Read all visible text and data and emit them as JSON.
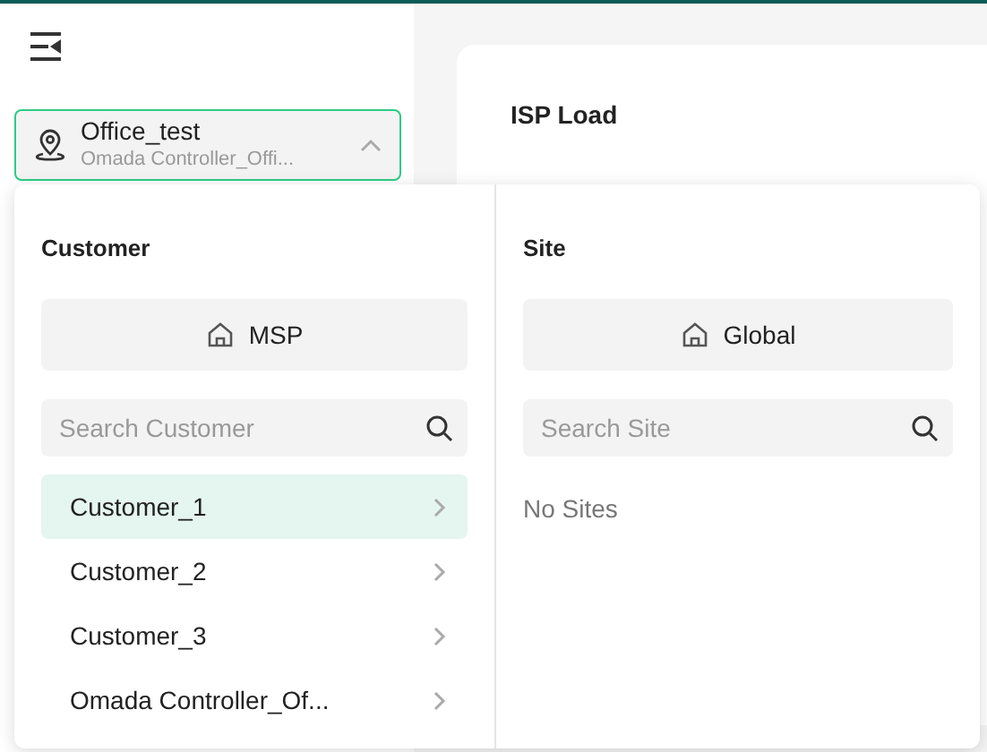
{
  "site_selector": {
    "title": "Office_test",
    "subtitle": "Omada Controller_Offi...",
    "expanded": true
  },
  "card": {
    "title": "ISP Load"
  },
  "dropdown": {
    "customer": {
      "heading": "Customer",
      "root_button": "MSP",
      "search": {
        "placeholder": "Search Customer"
      },
      "items": [
        {
          "label": "Customer_1",
          "selected": true
        },
        {
          "label": "Customer_2",
          "selected": false
        },
        {
          "label": "Customer_3",
          "selected": false
        },
        {
          "label": "Omada Controller_Of...",
          "selected": false
        }
      ]
    },
    "site": {
      "heading": "Site",
      "root_button": "Global",
      "search": {
        "placeholder": "Search Site"
      },
      "empty_text": "No Sites"
    }
  }
}
